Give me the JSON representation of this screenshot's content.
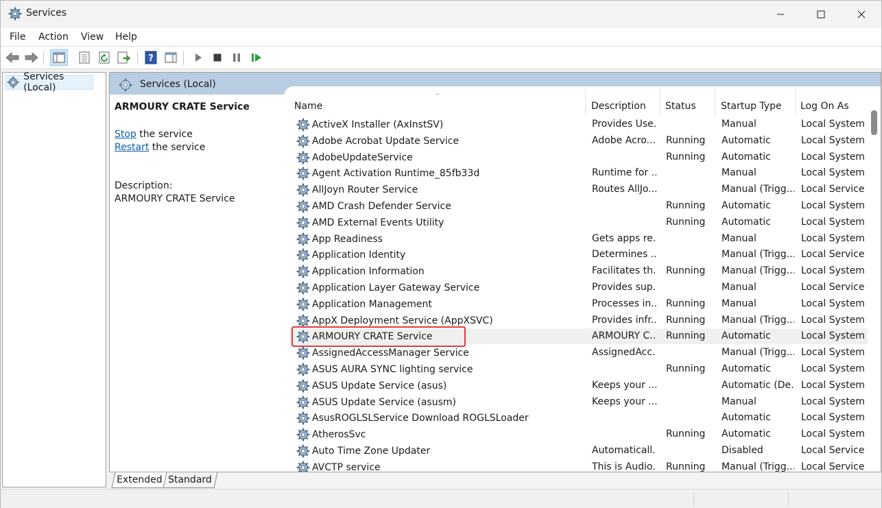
{
  "window": {
    "title": "Services",
    "icon": "services-gear-icon"
  },
  "menu": {
    "items": [
      "File",
      "Action",
      "View",
      "Help"
    ]
  },
  "toolbar": {
    "icons": [
      "back-arrow-icon",
      "forward-arrow-icon",
      "show-hide-console-tree-icon",
      "properties-icon",
      "refresh-icon",
      "export-list-icon",
      "help-icon",
      "show-hide-action-pane-icon",
      "start-service-icon",
      "stop-service-icon",
      "pause-service-icon",
      "restart-service-icon"
    ]
  },
  "tree": {
    "root_label": "Services (Local)"
  },
  "pane": {
    "header": "Services (Local)"
  },
  "detail": {
    "title": "ARMOURY CRATE Service",
    "stop_link": "Stop",
    "stop_rest": " the service",
    "restart_link": "Restart",
    "restart_rest": " the service",
    "desc_label": "Description:",
    "desc_text": "ARMOURY CRATE Service"
  },
  "columns": {
    "name": "Name",
    "description": "Description",
    "status": "Status",
    "startup": "Startup Type",
    "logon": "Log On As"
  },
  "rows": [
    {
      "name": "ActiveX Installer (AxInstSV)",
      "desc": "Provides Use...",
      "status": "",
      "startup": "Manual",
      "logon": "Local System"
    },
    {
      "name": "Adobe Acrobat Update Service",
      "desc": "Adobe Acro...",
      "status": "Running",
      "startup": "Automatic",
      "logon": "Local System"
    },
    {
      "name": "AdobeUpdateService",
      "desc": "",
      "status": "Running",
      "startup": "Automatic",
      "logon": "Local System"
    },
    {
      "name": "Agent Activation Runtime_85fb33d",
      "desc": "Runtime for ...",
      "status": "",
      "startup": "Manual",
      "logon": "Local System"
    },
    {
      "name": "AllJoyn Router Service",
      "desc": "Routes AllJo...",
      "status": "",
      "startup": "Manual (Trigg...",
      "logon": "Local Service"
    },
    {
      "name": "AMD Crash Defender Service",
      "desc": "",
      "status": "Running",
      "startup": "Automatic",
      "logon": "Local System"
    },
    {
      "name": "AMD External Events Utility",
      "desc": "",
      "status": "Running",
      "startup": "Automatic",
      "logon": "Local System"
    },
    {
      "name": "App Readiness",
      "desc": "Gets apps re...",
      "status": "",
      "startup": "Manual",
      "logon": "Local System"
    },
    {
      "name": "Application Identity",
      "desc": "Determines ...",
      "status": "",
      "startup": "Manual (Trigg...",
      "logon": "Local Service"
    },
    {
      "name": "Application Information",
      "desc": "Facilitates th...",
      "status": "Running",
      "startup": "Manual (Trigg...",
      "logon": "Local System"
    },
    {
      "name": "Application Layer Gateway Service",
      "desc": "Provides sup...",
      "status": "",
      "startup": "Manual",
      "logon": "Local Service"
    },
    {
      "name": "Application Management",
      "desc": "Processes in...",
      "status": "Running",
      "startup": "Manual",
      "logon": "Local System"
    },
    {
      "name": "AppX Deployment Service (AppXSVC)",
      "desc": "Provides infr...",
      "status": "Running",
      "startup": "Manual (Trigg...",
      "logon": "Local System"
    },
    {
      "name": "ARMOURY CRATE Service",
      "desc": "ARMOURY C...",
      "status": "Running",
      "startup": "Automatic",
      "logon": "Local System",
      "selected": true
    },
    {
      "name": "AssignedAccessManager Service",
      "desc": "AssignedAcc...",
      "status": "",
      "startup": "Manual (Trigg...",
      "logon": "Local System"
    },
    {
      "name": "ASUS AURA SYNC lighting service",
      "desc": "",
      "status": "Running",
      "startup": "Automatic",
      "logon": "Local System"
    },
    {
      "name": "ASUS Update Service (asus)",
      "desc": "Keeps your ...",
      "status": "",
      "startup": "Automatic (De...",
      "logon": "Local System"
    },
    {
      "name": "ASUS Update Service (asusm)",
      "desc": "Keeps your ...",
      "status": "",
      "startup": "Manual",
      "logon": "Local System"
    },
    {
      "name": "AsusROGLSLService Download ROGLSLoader",
      "desc": "",
      "status": "",
      "startup": "Automatic",
      "logon": "Local System"
    },
    {
      "name": "AtherosSvc",
      "desc": "",
      "status": "Running",
      "startup": "Automatic",
      "logon": "Local System"
    },
    {
      "name": "Auto Time Zone Updater",
      "desc": "Automaticall...",
      "status": "",
      "startup": "Disabled",
      "logon": "Local Service"
    },
    {
      "name": "AVCTP service",
      "desc": "This is Audio...",
      "status": "Running",
      "startup": "Manual (Trigg...",
      "logon": "Local Service"
    }
  ],
  "tabs": [
    "Extended",
    "Standard"
  ],
  "colors": {
    "pane_header": "#b9cde2",
    "link": "#0b5cad",
    "highlight": "#e03b3b",
    "selected_row": "#f0f0f0"
  }
}
